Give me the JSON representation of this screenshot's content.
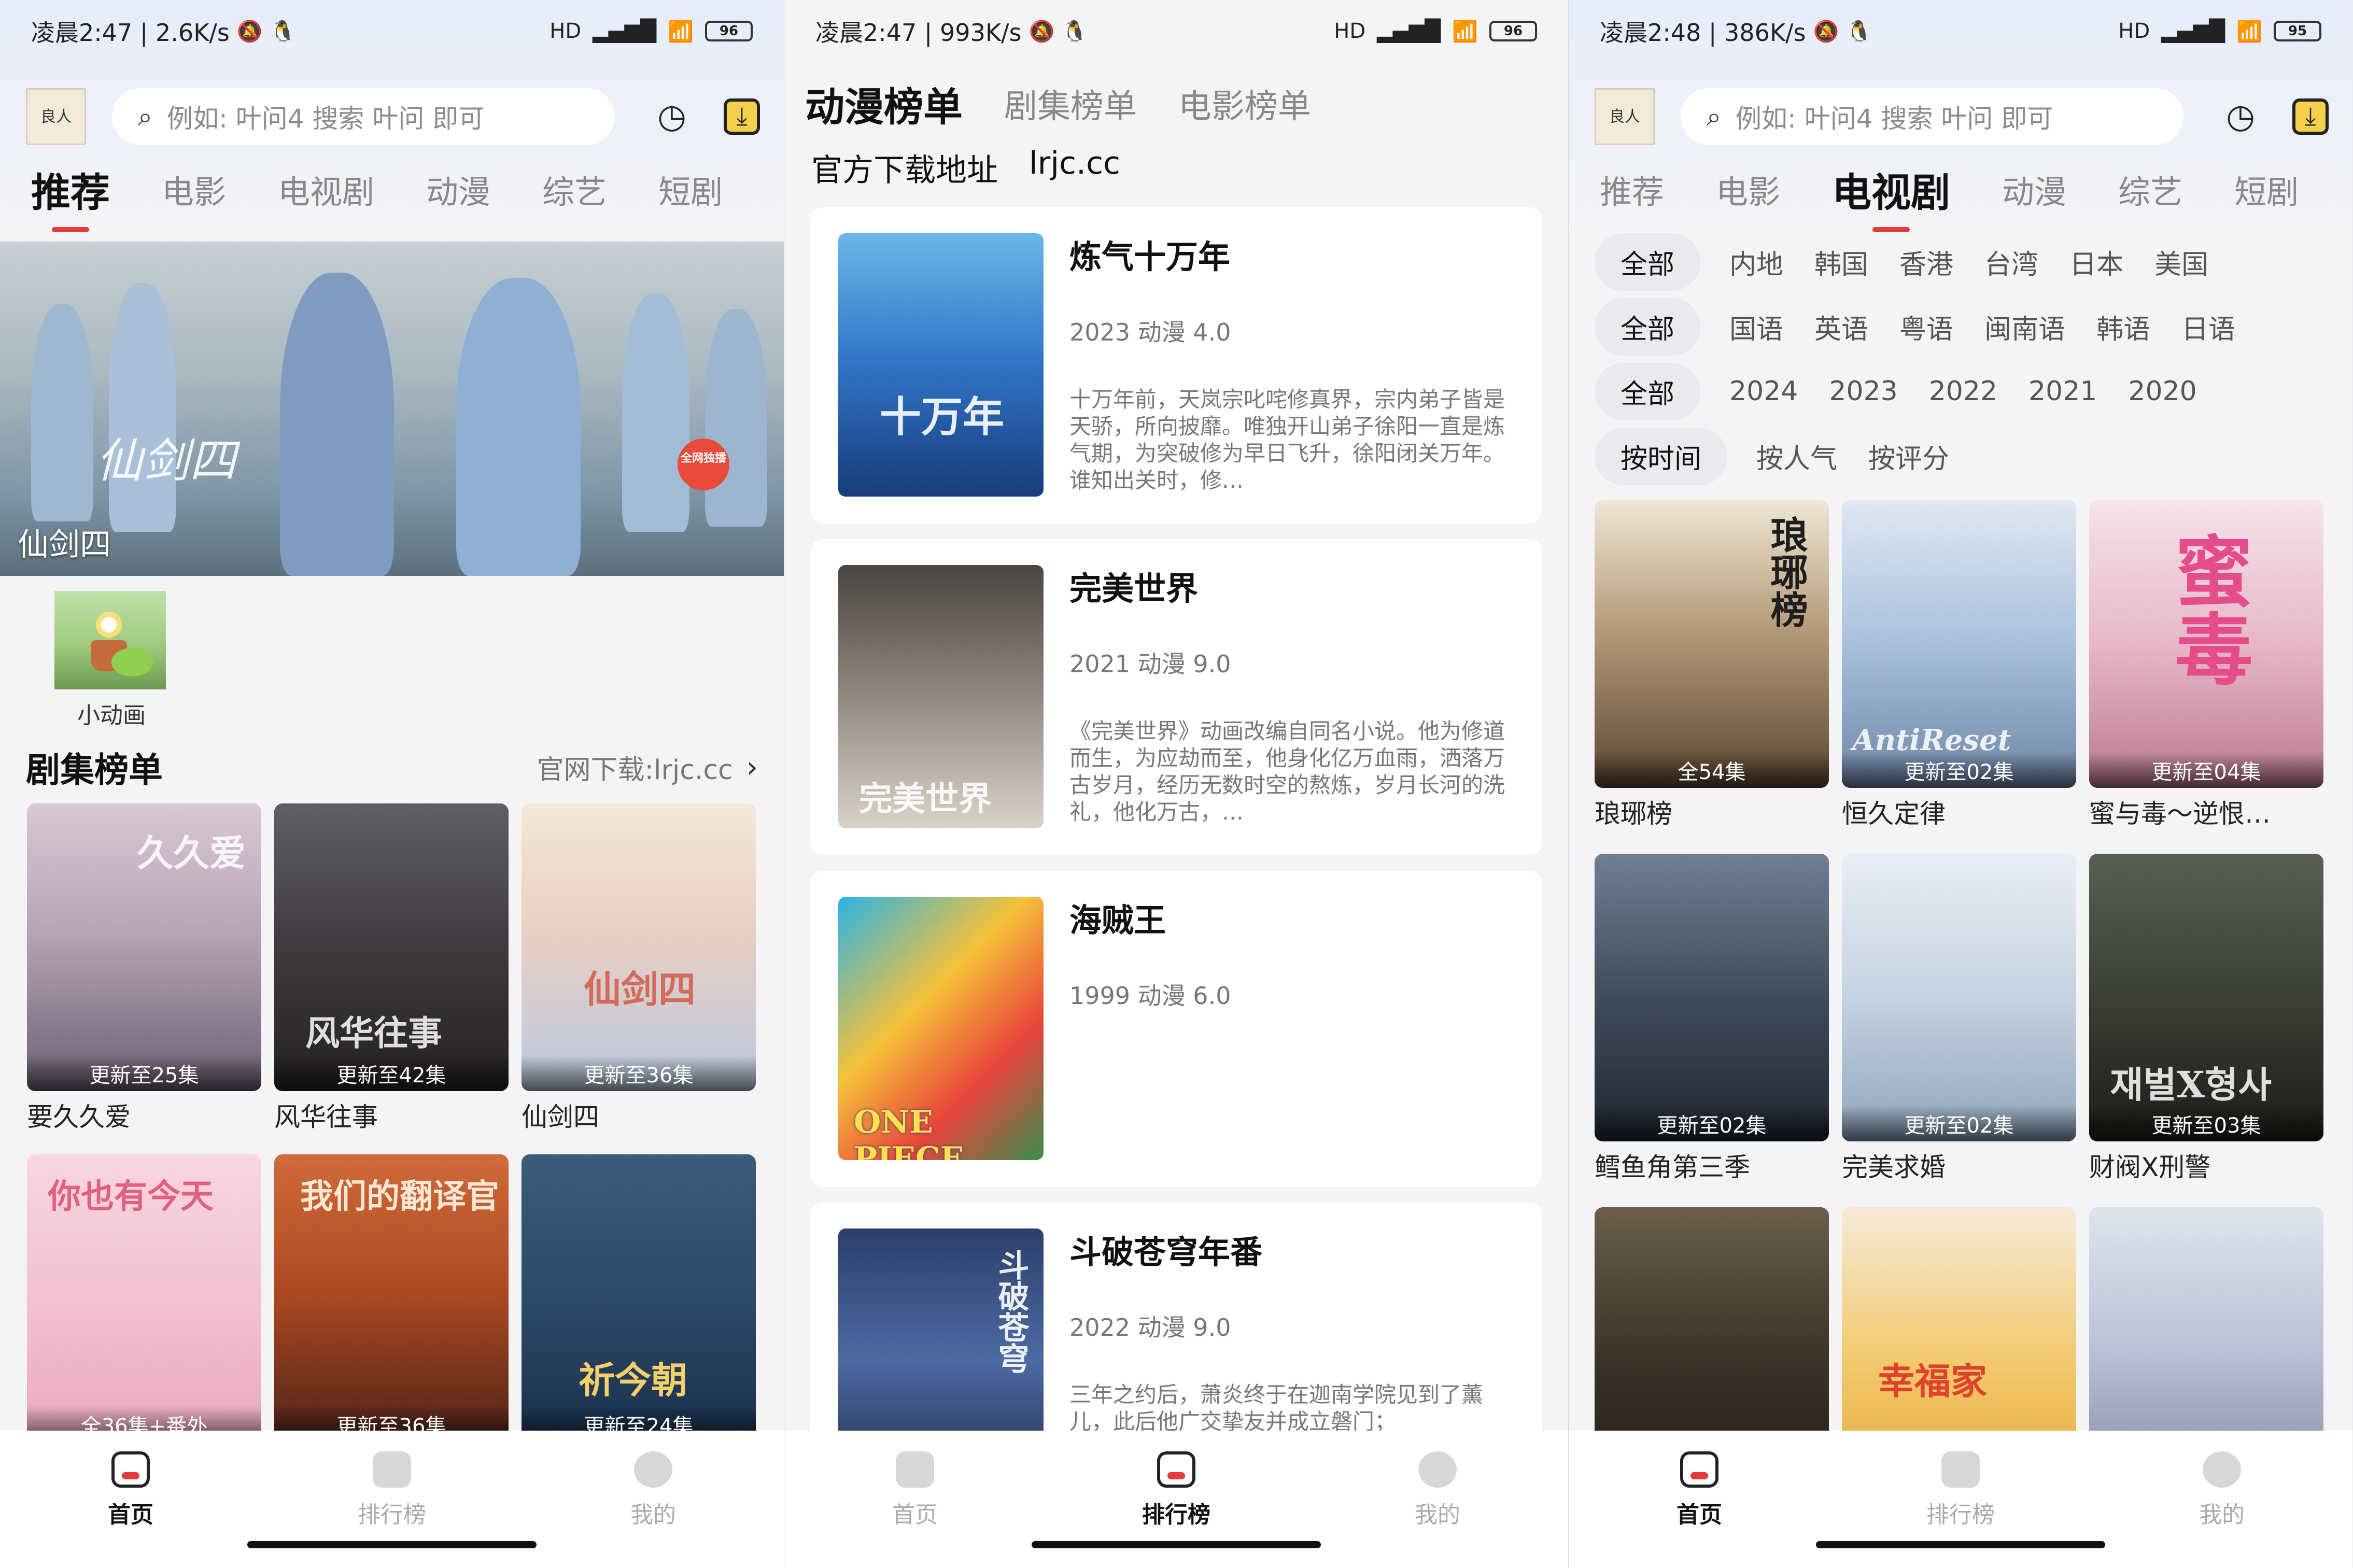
{
  "panel1": {
    "status": {
      "time_speed": "凌晨2:47 | 2.6K/s",
      "signal": "HD",
      "battery": "96"
    },
    "logo_text": "良人",
    "search_placeholder": "例如: 叶问4 搜索 叶问 即可",
    "tabs": [
      "推荐",
      "电影",
      "电视剧",
      "动漫",
      "综艺",
      "短剧"
    ],
    "hero_caption": "仙剑四",
    "hero_brand": "仙剑四",
    "hero_badge": "全网独播",
    "mini_entry_label": "小动画",
    "section_title": "剧集榜单",
    "section_more": "官网下载:lrjc.cc",
    "cards": [
      {
        "name": "要久久爱",
        "ep": "更新至25集",
        "deco": "久久爱"
      },
      {
        "name": "风华往事",
        "ep": "更新至42集",
        "deco": "风华往事"
      },
      {
        "name": "仙剑四",
        "ep": "更新至36集",
        "deco": "仙剑四"
      },
      {
        "name": "",
        "ep": "全36集+番外",
        "deco": "你也有今天"
      },
      {
        "name": "",
        "ep": "更新至36集",
        "deco": "我们的翻译官"
      },
      {
        "name": "",
        "ep": "更新至24集",
        "deco": "祈今朝"
      }
    ]
  },
  "panel2": {
    "status": {
      "time_speed": "凌晨2:47 | 993K/s",
      "signal": "HD",
      "battery": "96"
    },
    "tabs": [
      "动漫榜单",
      "剧集榜单",
      "电影榜单"
    ],
    "official_label": "官方下载地址",
    "official_url": "lrjc.cc",
    "items": [
      {
        "title": "炼气十万年",
        "meta": "2023 动漫 4.0",
        "desc": "十万年前，天岚宗叱咤修真界，宗内弟子皆是天骄，所向披靡。唯独开山弟子徐阳一直是炼气期，为突破修为早日飞升，徐阳闭关万年。谁知出关时，修…",
        "deco": "十万年"
      },
      {
        "title": "完美世界",
        "meta": "2021 动漫 9.0",
        "desc": "《完美世界》动画改编自同名小说。他为修道而生，为应劫而至，他身化亿万血雨，洒落万古岁月，经历无数时空的熬炼，岁月长河的洗礼，他化万古，…",
        "deco": "完美世界"
      },
      {
        "title": "海贼王",
        "meta": "1999 动漫 6.0",
        "desc": "",
        "deco": "ONE PIECE"
      },
      {
        "title": "斗破苍穹年番",
        "meta": "2022 动漫 9.0",
        "desc": "三年之约后，萧炎终于在迦南学院见到了薰儿，此后他广交挚友并成立磐门；",
        "deco": "斗破苍穹"
      }
    ]
  },
  "panel3": {
    "status": {
      "time_speed": "凌晨2:48 | 386K/s",
      "signal": "HD",
      "battery": "95"
    },
    "logo_text": "良人",
    "search_placeholder": "例如: 叶问4 搜索 叶问 即可",
    "tabs": [
      "推荐",
      "电影",
      "电视剧",
      "动漫",
      "综艺",
      "短剧"
    ],
    "filters": {
      "region": [
        "全部",
        "内地",
        "韩国",
        "香港",
        "台湾",
        "日本",
        "美国"
      ],
      "language": [
        "全部",
        "国语",
        "英语",
        "粤语",
        "闽南语",
        "韩语",
        "日语"
      ],
      "year": [
        "全部",
        "2024",
        "2023",
        "2022",
        "2021",
        "2020"
      ],
      "sort": [
        "按时间",
        "按人气",
        "按评分"
      ]
    },
    "cards": [
      {
        "name": "琅琊榜",
        "ep": "全54集",
        "deco": "琅琊榜"
      },
      {
        "name": "恒久定律",
        "ep": "更新至02集",
        "deco": "AntiReset"
      },
      {
        "name": "蜜与毒～逆恨…",
        "ep": "更新至04集",
        "deco": "蜜毒"
      },
      {
        "name": "鳕鱼角第三季",
        "ep": "更新至02集",
        "deco": ""
      },
      {
        "name": "完美求婚",
        "ep": "更新至02集",
        "deco": ""
      },
      {
        "name": "财阀X刑警",
        "ep": "更新至03集",
        "deco": "재벌X형사"
      },
      {
        "name": "",
        "ep": "",
        "deco": ""
      },
      {
        "name": "",
        "ep": "",
        "deco": "幸福家"
      },
      {
        "name": "",
        "ep": "",
        "deco": ""
      }
    ]
  },
  "nav": [
    "首页",
    "排行榜",
    "我的"
  ]
}
